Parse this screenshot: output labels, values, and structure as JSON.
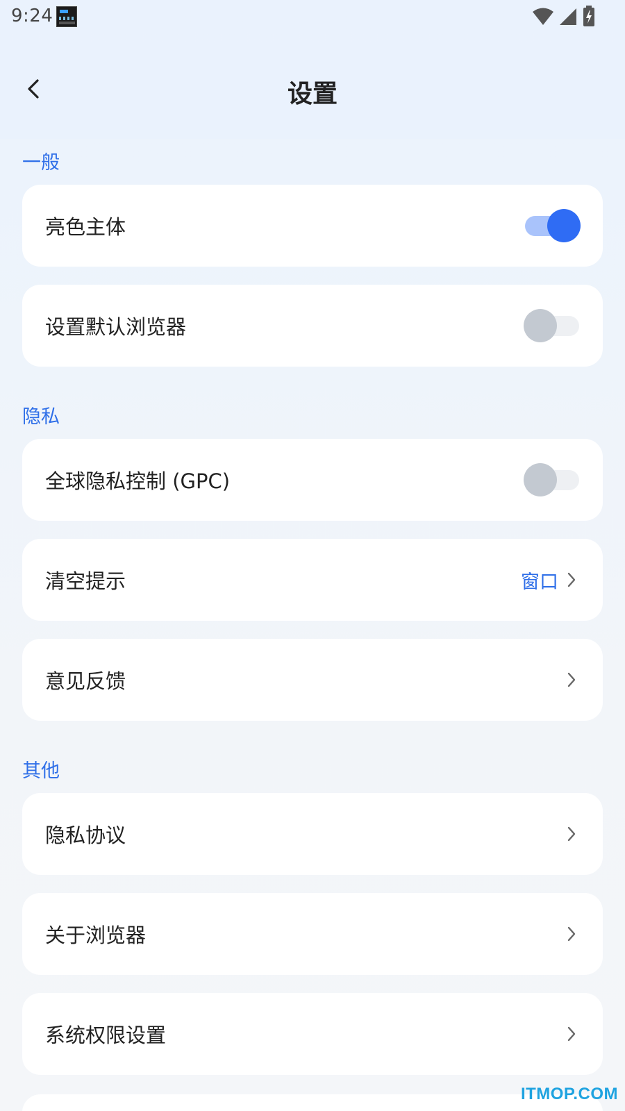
{
  "status_bar": {
    "time": "9:24",
    "icons": [
      "wifi-icon",
      "signal-icon",
      "battery-charging-icon"
    ]
  },
  "header": {
    "title": "设置",
    "back_icon": "back-arrow-icon"
  },
  "sections": {
    "general": {
      "label": "一般",
      "light_theme": {
        "label": "亮色主体",
        "enabled": true
      },
      "default_browser": {
        "label": "设置默认浏览器",
        "enabled": false
      }
    },
    "privacy": {
      "label": "隐私",
      "gpc": {
        "label": "全球隐私控制 (GPC)",
        "enabled": false
      },
      "clear_prompt": {
        "label": "清空提示",
        "value": "窗口"
      },
      "feedback": {
        "label": "意见反馈"
      }
    },
    "other": {
      "label": "其他",
      "privacy_policy": {
        "label": "隐私协议"
      },
      "about_browser": {
        "label": "关于浏览器"
      },
      "system_permissions": {
        "label": "系统权限设置"
      }
    }
  },
  "watermark": "ITMOP.COM",
  "colors": {
    "accent": "#2f6fe8",
    "toggle_on_knob": "#2f6cf4",
    "toggle_on_track": "#a9c3fb",
    "toggle_off_knob": "#c3c9d1",
    "background": "#eaf2fd"
  }
}
